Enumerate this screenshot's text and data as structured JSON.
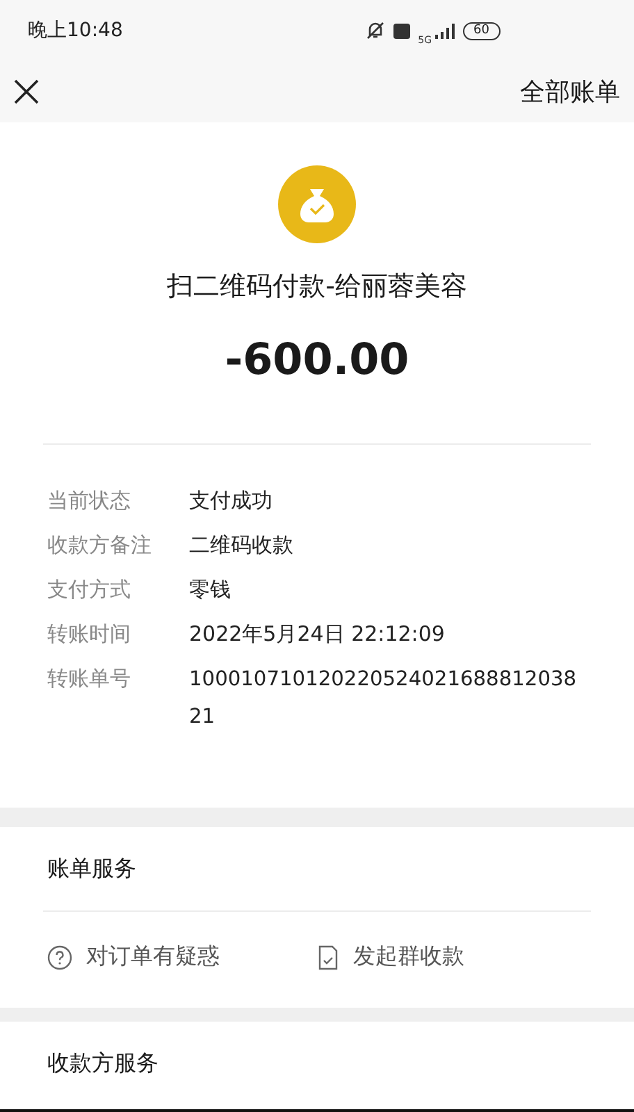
{
  "status_bar": {
    "time": "晚上10:48",
    "network": "5G",
    "battery": "60"
  },
  "nav": {
    "right_link": "全部账单"
  },
  "payment": {
    "title": "扫二维码付款-给丽蓉美容",
    "amount": "-600.00"
  },
  "details": [
    {
      "label": "当前状态",
      "value": "支付成功"
    },
    {
      "label": "收款方备注",
      "value": "二维码收款"
    },
    {
      "label": "支付方式",
      "value": "零钱"
    },
    {
      "label": "转账时间",
      "value": "2022年5月24日 22:12:09"
    },
    {
      "label": "转账单号",
      "value": "10001071012022052402168881203821",
      "kind": "number"
    }
  ],
  "bill_services": {
    "title": "账单服务",
    "actions": [
      {
        "label": "对订单有疑惑",
        "kind": "question"
      },
      {
        "label": "发起群收款",
        "kind": "group"
      }
    ]
  },
  "payee_services": {
    "title": "收款方服务"
  }
}
